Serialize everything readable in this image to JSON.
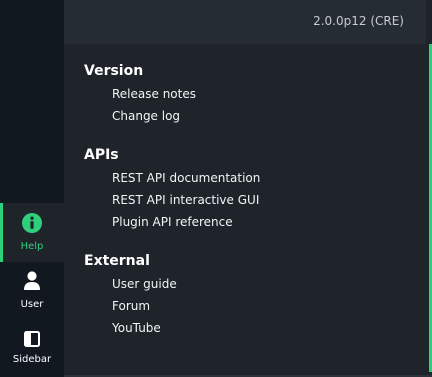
{
  "sidebar": {
    "items": [
      {
        "label": "Help",
        "icon": "info-icon",
        "active": true
      },
      {
        "label": "User",
        "icon": "user-icon",
        "active": false
      },
      {
        "label": "Sidebar",
        "icon": "sidebar-icon",
        "active": false
      }
    ]
  },
  "header": {
    "version": "2.0.0p12 (CRE)"
  },
  "sections": [
    {
      "title": "Version",
      "links": [
        "Release notes",
        "Change log"
      ]
    },
    {
      "title": "APIs",
      "links": [
        "REST API documentation",
        "REST API interactive GUI",
        "Plugin API reference"
      ]
    },
    {
      "title": "External",
      "links": [
        "User guide",
        "Forum",
        "YouTube"
      ]
    }
  ],
  "colors": {
    "accent": "#2ed07c",
    "sidebar_bg": "#121820",
    "panel_bg": "#1f242b"
  }
}
